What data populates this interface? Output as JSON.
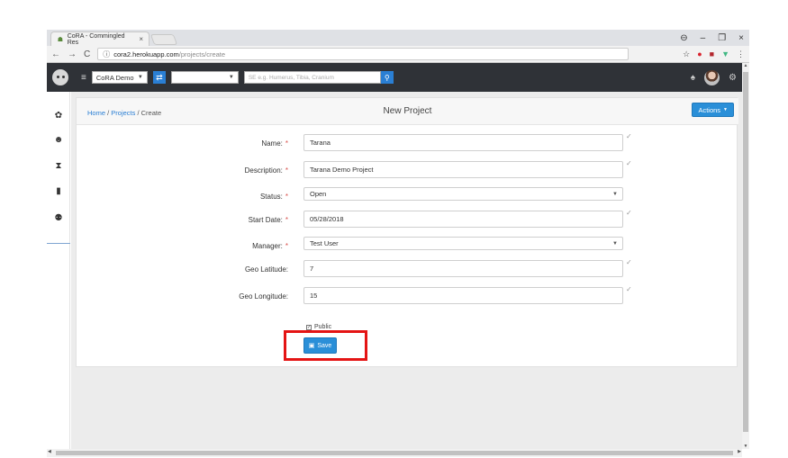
{
  "browser": {
    "tab_title": "CoRA - Commingled Res",
    "tab_close": "×",
    "url_host": "cora2.herokuapp.com",
    "url_path": "/projects/create",
    "win_controls": [
      "⊖",
      "–",
      "❐",
      "×"
    ]
  },
  "appbar": {
    "org_select": "CoRA Demo",
    "project_select": "",
    "search_placeholder": "SE e.g. Humerus, Tibia, Cranium"
  },
  "breadcrumb": {
    "home": "Home",
    "sep1": " / ",
    "projects": "Projects",
    "sep2": " / ",
    "current": "Create"
  },
  "page": {
    "title": "New Project",
    "actions_label": "Actions"
  },
  "form": {
    "required_mark": "*",
    "check_mark": "✓",
    "fields": [
      {
        "label": "Name:",
        "value": "Tarana",
        "required": true
      },
      {
        "label": "Description:",
        "value": "Tarana Demo Project",
        "required": true
      },
      {
        "label": "Status:",
        "value": "Open",
        "required": true
      },
      {
        "label": "Start Date:",
        "value": "05/28/2018",
        "required": true
      },
      {
        "label": "Manager:",
        "value": "Test User",
        "required": true
      },
      {
        "label": "Geo Latitude:",
        "value": "7",
        "required": false
      },
      {
        "label": "Geo Longitude:",
        "value": "15",
        "required": false
      }
    ],
    "public_label": "Public",
    "public_checked": true,
    "save_label": "Save"
  },
  "colors": {
    "appbar": "#2f3237",
    "accent": "#2a8fd8",
    "highlight": "#e41414",
    "required": "#d9534f"
  }
}
